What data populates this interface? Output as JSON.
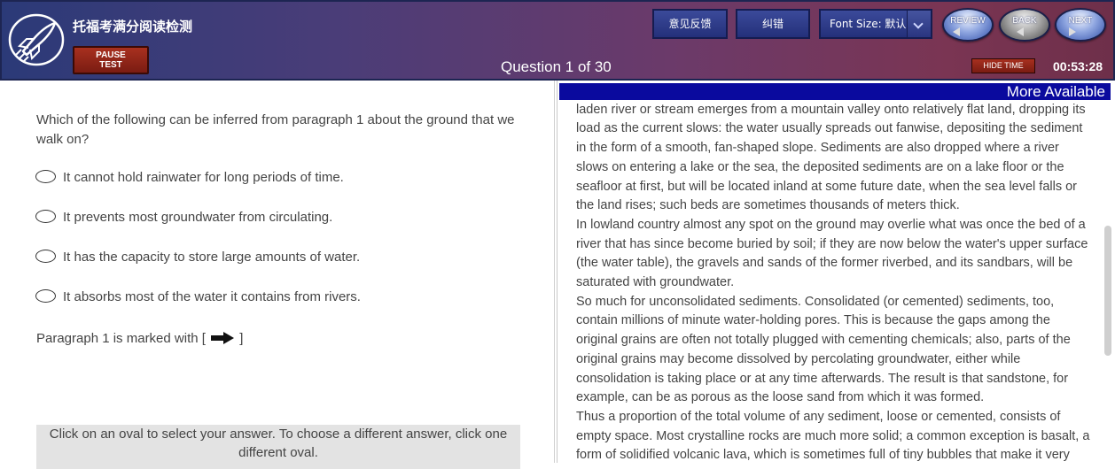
{
  "header": {
    "app_title": "托福考满分阅读检测",
    "pause_label": [
      "PAUSE",
      "TEST"
    ],
    "question_counter": "Question 1 of 30",
    "feedback_label": "意见反馈",
    "correct_error_label": "纠错",
    "font_size_label": "Font Size: 默认",
    "review_label": "REVIEW",
    "back_label": "BACK",
    "next_label": "NEXT",
    "hide_time_label": "HIDE TIME",
    "timer": "00:53:28"
  },
  "question": {
    "text": "Which of the following can be inferred from paragraph 1 about the ground that we walk on?",
    "options": [
      "It cannot hold rainwater for long periods of time.",
      "It prevents most groundwater from circulating.",
      "It has the capacity to store large amounts of water.",
      "It absorbs most of the water it contains from rivers."
    ],
    "paragraph_note_before": "Paragraph 1 is marked with [",
    "paragraph_note_after": "]",
    "instructions": "Click on an oval to select your answer. To choose a different answer, click one different oval."
  },
  "passage": {
    "more_available": "More Available",
    "paragraphs": [
      "The same thing happens to this day, though on a smaller scale, wherever a sediment-laden river or stream emerges from a mountain valley onto relatively flat land, dropping its load as the current slows: the water usually spreads out fanwise, depositing the sediment in the form of a smooth, fan-shaped slope. Sediments are also dropped where a river slows on entering a lake or the sea, the deposited sediments are on a lake floor or the seafloor at first, but will be located inland at some future date, when the sea level falls or the land rises; such beds are sometimes thousands of meters thick.",
      "In lowland country almost any spot on the ground may overlie what was once the bed of a river that has since become buried by soil; if they are now below the water's upper surface (the water table), the gravels and sands of the former riverbed, and its sandbars, will be saturated with groundwater.",
      "So much for unconsolidated sediments. Consolidated (or cemented) sediments, too, contain millions of minute water-holding pores. This is because the gaps among the original grains are often not totally plugged with cementing chemicals; also, parts of the original grains may become dissolved by percolating groundwater, either while consolidation is taking place or at any time afterwards. The result is that sandstone, for example, can be as porous as the loose sand from which it was formed.",
      "Thus a proportion of the total volume of any sediment, loose or cemented, consists of empty space. Most crystalline rocks are much more solid; a common exception is basalt, a form of solidified volcanic lava, which is sometimes full of tiny bubbles that make it very"
    ]
  },
  "colors": {
    "header_start": "#2b3a78",
    "header_end": "#7a3553",
    "more_available_bg": "#0a0a9e",
    "instructions_bg": "#e3e3e3"
  },
  "icons": [
    "rocket-logo-icon",
    "chevron-down-icon",
    "review-arrow-icon",
    "back-arrow-icon",
    "next-arrow-icon",
    "paragraph-arrow-icon"
  ]
}
